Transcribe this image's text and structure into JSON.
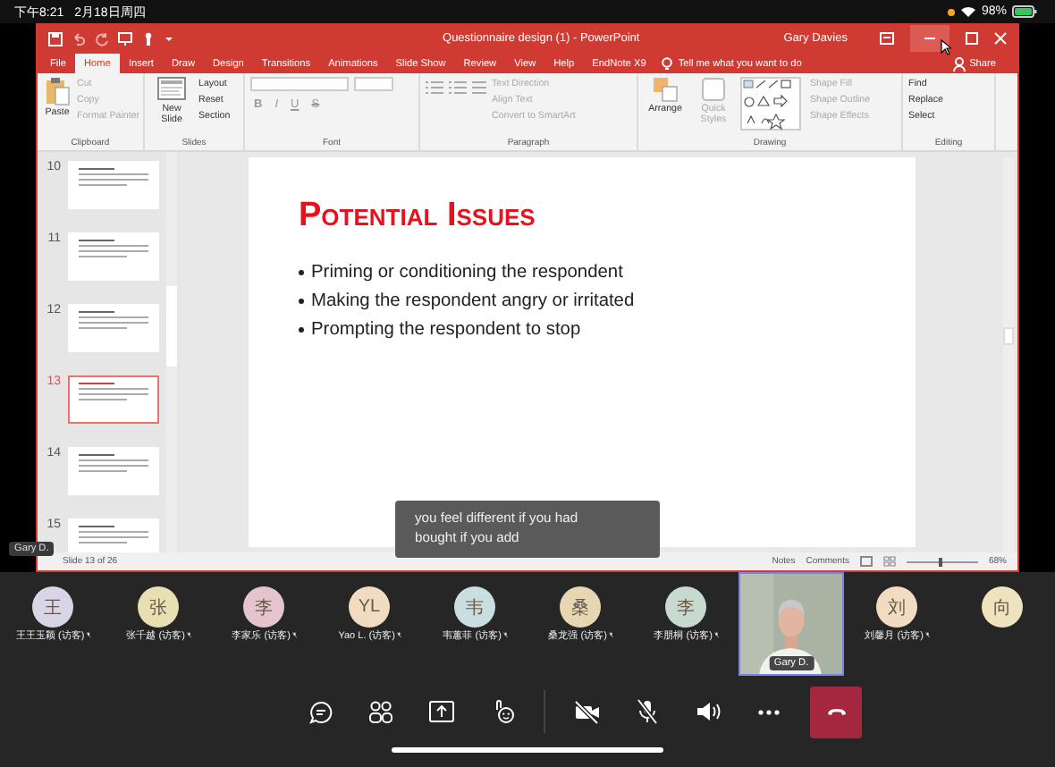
{
  "status_bar": {
    "time": "下午8:21",
    "date": "2月18日周四",
    "battery": "98%"
  },
  "window": {
    "title": "Questionnaire design (1)  -  PowerPoint",
    "user": "Gary Davies"
  },
  "tabs": [
    {
      "label": "File",
      "selected": false
    },
    {
      "label": "Home",
      "selected": true
    },
    {
      "label": "Insert",
      "selected": false
    },
    {
      "label": "Draw",
      "selected": false
    },
    {
      "label": "Design",
      "selected": false
    },
    {
      "label": "Transitions",
      "selected": false
    },
    {
      "label": "Animations",
      "selected": false
    },
    {
      "label": "Slide Show",
      "selected": false
    },
    {
      "label": "Review",
      "selected": false
    },
    {
      "label": "View",
      "selected": false
    },
    {
      "label": "Help",
      "selected": false
    },
    {
      "label": "EndNote X9",
      "selected": false
    }
  ],
  "tell_me": "Tell me what you want to do",
  "share": "Share",
  "ribbon": [
    {
      "kind": "clipboard",
      "label": "Clipboard",
      "large": [
        {
          "label": "Paste",
          "disabled": false
        }
      ],
      "items": [
        {
          "label": "Cut",
          "disabled": true
        },
        {
          "label": "Copy",
          "disabled": true
        },
        {
          "label": "Format Painter",
          "disabled": true
        }
      ]
    },
    {
      "kind": "slides",
      "label": "Slides",
      "large": [
        {
          "label": "New Slide",
          "disabled": false
        }
      ],
      "items": [
        {
          "label": "Layout",
          "disabled": false
        },
        {
          "label": "Reset",
          "disabled": false
        },
        {
          "label": "Section",
          "disabled": false
        }
      ]
    },
    {
      "kind": "font",
      "label": "Font",
      "format": [
        "B",
        "I",
        "U",
        "S"
      ]
    },
    {
      "kind": "paragraph",
      "label": "Paragraph",
      "items": [
        {
          "label": "Text Direction",
          "disabled": true
        },
        {
          "label": "Align Text",
          "disabled": true
        },
        {
          "label": "Convert to SmartArt",
          "disabled": true
        }
      ]
    },
    {
      "kind": "drawing",
      "label": "Drawing",
      "large": [
        {
          "label": "Arrange",
          "disabled": false
        },
        {
          "label": "Quick Styles",
          "disabled": true
        }
      ],
      "items": [
        {
          "label": "Shape Fill",
          "disabled": true
        },
        {
          "label": "Shape Outline",
          "disabled": true
        },
        {
          "label": "Shape Effects",
          "disabled": true
        }
      ]
    },
    {
      "kind": "editing",
      "label": "Editing",
      "items": [
        {
          "label": "Find",
          "disabled": false
        },
        {
          "label": "Replace",
          "disabled": false
        },
        {
          "label": "Select",
          "disabled": false
        }
      ]
    }
  ],
  "thumbnails": [
    {
      "number": "10",
      "selected": false
    },
    {
      "number": "11",
      "selected": false
    },
    {
      "number": "12",
      "selected": false
    },
    {
      "number": "13",
      "selected": true
    },
    {
      "number": "14",
      "selected": false
    },
    {
      "number": "15",
      "selected": false
    }
  ],
  "slide": {
    "title": "Potential Issues",
    "bullets": [
      "Priming or conditioning the respondent",
      "Making the respondent angry or irritated",
      "Prompting the respondent to stop"
    ]
  },
  "caption": {
    "lines": [
      "you feel different if you had",
      "bought if you add"
    ]
  },
  "ppt_status": {
    "slide": "Slide 13 of 26",
    "notes": "Notes",
    "comments": "Comments",
    "zoom": "68%",
    "zoom_slider": {
      "level": 0.45
    }
  },
  "presenter_label": "Gary D.",
  "participants": [
    {
      "kind": "avatar",
      "initials": "王",
      "name": "王王玉颖 (访客)",
      "color": "#d9d5e6",
      "muted": true
    },
    {
      "kind": "avatar",
      "initials": "张",
      "name": "张千越 (访客)",
      "color": "#e8dfb2",
      "muted": true
    },
    {
      "kind": "avatar",
      "initials": "李",
      "name": "李家乐 (访客)",
      "color": "#e6c4cd",
      "muted": true
    },
    {
      "kind": "avatar",
      "initials": "YL",
      "name": "Yao L. (访客)",
      "color": "#f0dcc0",
      "muted": true
    },
    {
      "kind": "avatar",
      "initials": "韦",
      "name": "韦蕙菲 (访客)",
      "color": "#c9dee1",
      "muted": true
    },
    {
      "kind": "avatar",
      "initials": "桑",
      "name": "桑龙强 (访客)",
      "color": "#e6d7b2",
      "muted": true
    },
    {
      "kind": "avatar",
      "initials": "李",
      "name": "李朋桐 (访客)",
      "color": "#c8d9cd",
      "muted": true
    },
    {
      "kind": "video",
      "name": "Gary D.",
      "speaking": true
    },
    {
      "kind": "avatar",
      "initials": "刘",
      "name": "刘馨月 (访客)",
      "color": "#f1dcc2",
      "muted": true
    },
    {
      "kind": "avatar",
      "initials": "向",
      "color": "#efe2bf"
    }
  ],
  "toolbar": [
    {
      "kind": "chat"
    },
    {
      "kind": "people"
    },
    {
      "kind": "share"
    },
    {
      "kind": "reactions"
    },
    {
      "kind": "separator"
    },
    {
      "kind": "camera",
      "off": true
    },
    {
      "kind": "mic",
      "off": true
    },
    {
      "kind": "speaker"
    },
    {
      "kind": "more"
    },
    {
      "kind": "hangup"
    }
  ]
}
